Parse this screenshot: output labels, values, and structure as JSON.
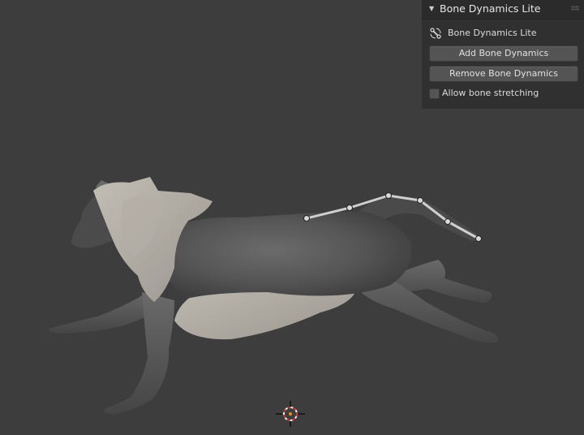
{
  "panel": {
    "title": "Bone Dynamics Lite",
    "section_label": "Bone Dynamics Lite",
    "section_icon": "bone-dynamics-icon",
    "add_button": "Add Bone Dynamics",
    "remove_button": "Remove Bone Dynamics",
    "checkbox_label": "Allow bone stretching",
    "checkbox_checked": false
  },
  "colors": {
    "viewport_bg": "#3d3d3d",
    "panel_bg": "#303030",
    "button_bg": "#545454",
    "cursor_ring": "#d23a3a"
  }
}
